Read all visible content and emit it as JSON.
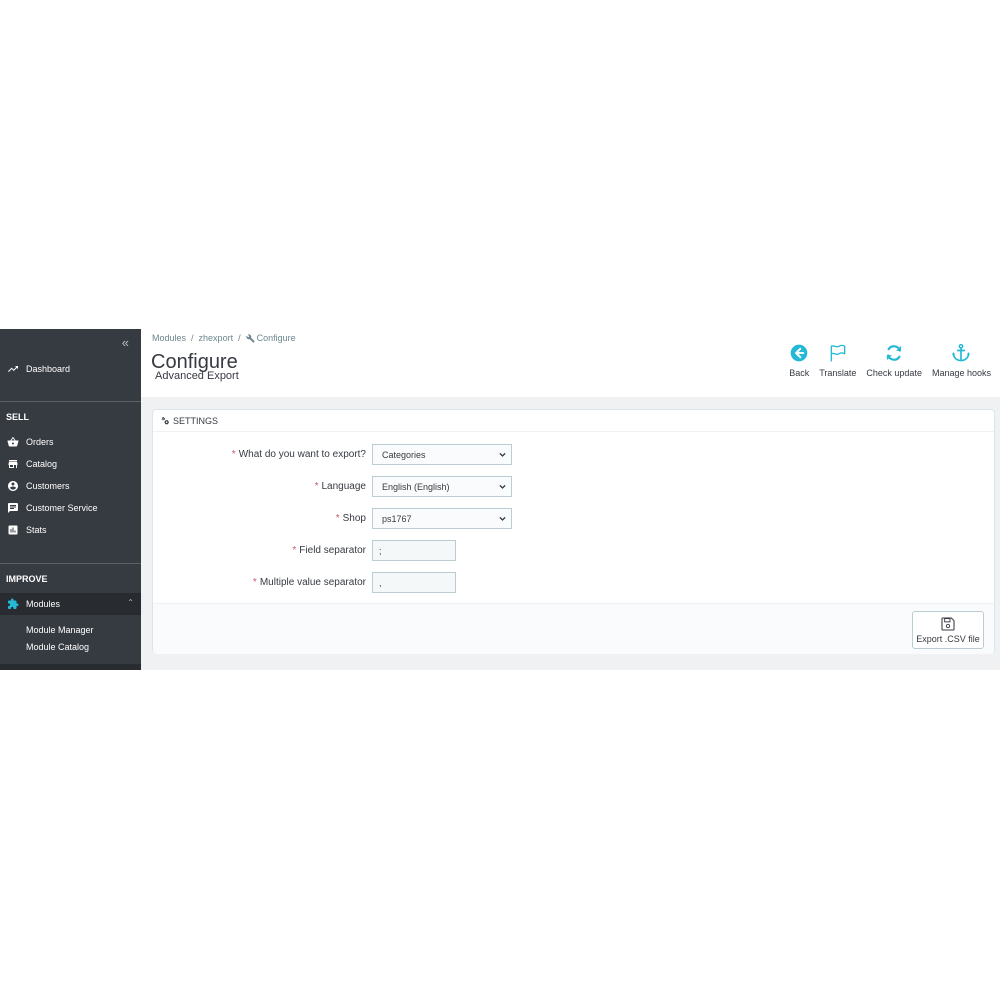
{
  "sidebar": {
    "collapse_label": "«",
    "dashboard": "Dashboard",
    "sell_title": "SELL",
    "sell_items": [
      "Orders",
      "Catalog",
      "Customers",
      "Customer Service",
      "Stats"
    ],
    "improve_title": "IMPROVE",
    "modules": "Modules",
    "module_sub": [
      "Module Manager",
      "Module Catalog"
    ]
  },
  "breadcrumb": {
    "items": [
      "Modules",
      "zhexport",
      "Configure"
    ],
    "separator": "/"
  },
  "header": {
    "title": "Configure",
    "subtitle": "Advanced Export"
  },
  "toolbar": {
    "back": "Back",
    "translate": "Translate",
    "check_update": "Check update",
    "manage_hooks": "Manage hooks",
    "icon_color": "#25b9d7"
  },
  "settings": {
    "title": "SETTINGS",
    "fields": [
      {
        "label": "What do you want to export?",
        "value": "Categories",
        "type": "select"
      },
      {
        "label": "Language",
        "value": "English (English)",
        "type": "select"
      },
      {
        "label": "Shop",
        "value": "ps1767",
        "type": "select"
      },
      {
        "label": "Field separator",
        "value": ";",
        "type": "text"
      },
      {
        "label": "Multiple value separator",
        "value": ",",
        "type": "text"
      }
    ],
    "required_mark": "*",
    "export_button": "Export .CSV file"
  }
}
